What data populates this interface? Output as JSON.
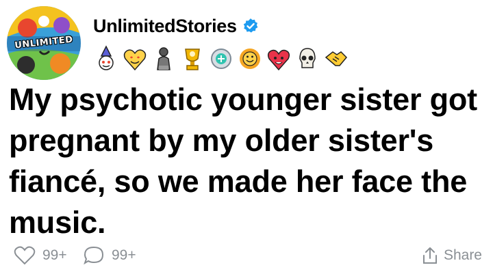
{
  "post": {
    "username": "UnlimitedStories",
    "avatar_text": "UNLIMITED",
    "verified": true,
    "title": "My psychotic younger sister got pregnant by my older sister's fiancé, so we made her face the music."
  },
  "badges": [
    "wizard-snoo-icon",
    "heart-eyes-icon",
    "thinker-statue-icon",
    "gold-trophy-snoo-icon",
    "silver-medal-icon",
    "sun-smile-icon",
    "heart-hands-icon",
    "skull-icon",
    "handshake-icon"
  ],
  "footer": {
    "likes": "99+",
    "comments": "99+",
    "share_label": "Share"
  },
  "colors": {
    "verified": "#1d9bf0",
    "muted": "#8a8f94"
  }
}
